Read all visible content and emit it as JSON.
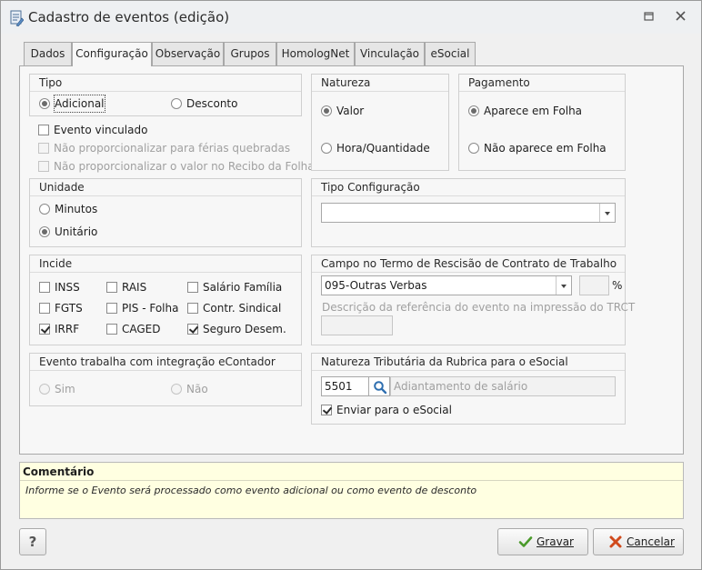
{
  "window": {
    "title": "Cadastro de eventos (edição)"
  },
  "tabs": [
    {
      "label": "Dados"
    },
    {
      "label": "Configuração"
    },
    {
      "label": "Observação"
    },
    {
      "label": "Grupos"
    },
    {
      "label": "HomologNet"
    },
    {
      "label": "Vinculação"
    },
    {
      "label": "eSocial"
    }
  ],
  "tipo": {
    "title": "Tipo",
    "adicional": "Adicional",
    "desconto": "Desconto",
    "selected": "Adicional"
  },
  "checks": {
    "evento_vinculado": "Evento vinculado",
    "nao_prop_ferias": "Não proporcionalizar para férias quebradas",
    "nao_prop_recibo": "Não proporcionalizar o valor no Recibo da Folha"
  },
  "natureza": {
    "title": "Natureza",
    "valor": "Valor",
    "hora_quantidade": "Hora/Quantidade",
    "selected": "Valor"
  },
  "pagamento": {
    "title": "Pagamento",
    "aparece": "Aparece em Folha",
    "nao_aparece": "Não aparece em Folha",
    "selected": "Aparece em Folha"
  },
  "unidade": {
    "title": "Unidade",
    "minutos": "Minutos",
    "unitario": "Unitário",
    "selected": "Unitário"
  },
  "tipo_config": {
    "title": "Tipo Configuração",
    "value": ""
  },
  "incide": {
    "title": "Incide",
    "inss": "INSS",
    "rais": "RAIS",
    "salario_familia": "Salário Família",
    "fgts": "FGTS",
    "pis_folha": "PIS - Folha",
    "contr_sindical": "Contr. Sindical",
    "irrf": "IRRF",
    "caged": "CAGED",
    "seguro_desem": "Seguro Desem."
  },
  "rescisao": {
    "title": "Campo no Termo de Rescisão de Contrato de Trabalho",
    "campo_value": "095-Outras Verbas",
    "percent_symbol": "%",
    "descricao_label": "Descrição da referência do evento na impressão do TRCT"
  },
  "econtador": {
    "title": "Evento trabalha com integração eContador",
    "sim": "Sim",
    "nao": "Não"
  },
  "esocial": {
    "title": "Natureza Tributária da Rubrica para o eSocial",
    "codigo": "5501",
    "descricao": "Adiantamento de salário",
    "enviar": "Enviar para o eSocial"
  },
  "comentario": {
    "title": "Comentário",
    "text": "Informe se o Evento será processado como evento adicional ou como evento de desconto"
  },
  "buttons": {
    "help": "?",
    "gravar": "Gravar",
    "cancelar": "Cancelar"
  },
  "colors": {
    "comment_bg": "#ffffe1",
    "ok_green": "#4a9a2a",
    "cancel_red": "#d04a1c",
    "search_blue": "#2f6fb0"
  }
}
